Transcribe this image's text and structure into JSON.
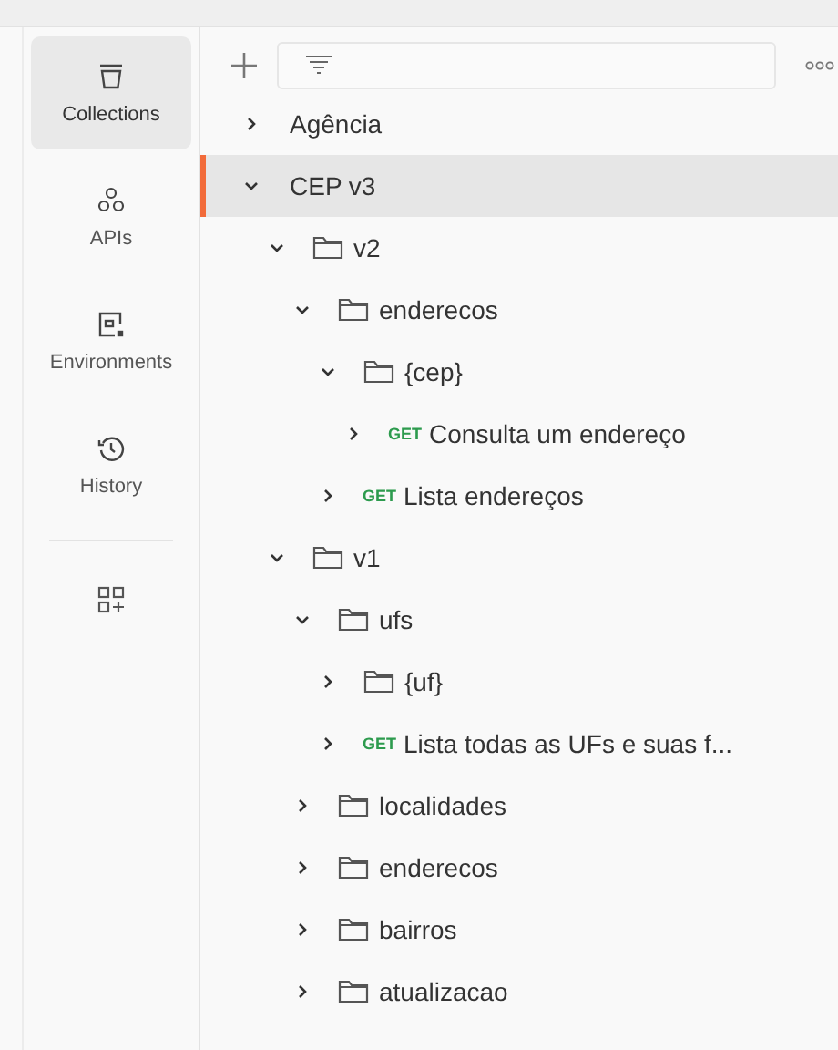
{
  "sidebar": {
    "items": [
      {
        "kind": "collections",
        "label": "Collections",
        "selected": true
      },
      {
        "kind": "apis",
        "label": "APIs",
        "selected": false
      },
      {
        "kind": "environments",
        "label": "Environments",
        "selected": false
      },
      {
        "kind": "history",
        "label": "History",
        "selected": false
      }
    ]
  },
  "tree": [
    {
      "kind": "collection",
      "label": "Agência",
      "expanded": false,
      "selected": false
    },
    {
      "kind": "collection",
      "label": "CEP v3",
      "expanded": true,
      "selected": true,
      "children": [
        {
          "kind": "folder",
          "label": "v2",
          "expanded": true,
          "selected": false,
          "children": [
            {
              "kind": "folder",
              "label": "enderecos",
              "expanded": true,
              "selected": false,
              "children": [
                {
                  "kind": "folder",
                  "label": "{cep}",
                  "expanded": true,
                  "selected": false,
                  "children": [
                    {
                      "kind": "request",
                      "method": "GET",
                      "label": "Consulta um endereço",
                      "expanded": false,
                      "selected": false
                    }
                  ]
                },
                {
                  "kind": "request",
                  "method": "GET",
                  "label": "Lista endereços",
                  "expanded": false,
                  "selected": false
                }
              ]
            }
          ]
        },
        {
          "kind": "folder",
          "label": "v1",
          "expanded": true,
          "selected": false,
          "children": [
            {
              "kind": "folder",
              "label": "ufs",
              "expanded": true,
              "selected": false,
              "children": [
                {
                  "kind": "folder",
                  "label": "{uf}",
                  "expanded": false,
                  "selected": false
                },
                {
                  "kind": "request",
                  "method": "GET",
                  "label": "Lista todas as UFs e suas f...",
                  "expanded": false,
                  "selected": false
                }
              ]
            },
            {
              "kind": "folder",
              "label": "localidades",
              "expanded": false,
              "selected": false
            },
            {
              "kind": "folder",
              "label": "enderecos",
              "expanded": false,
              "selected": false
            },
            {
              "kind": "folder",
              "label": "bairros",
              "expanded": false,
              "selected": false
            },
            {
              "kind": "folder",
              "label": "atualizacao",
              "expanded": false,
              "selected": false
            }
          ]
        }
      ]
    }
  ]
}
